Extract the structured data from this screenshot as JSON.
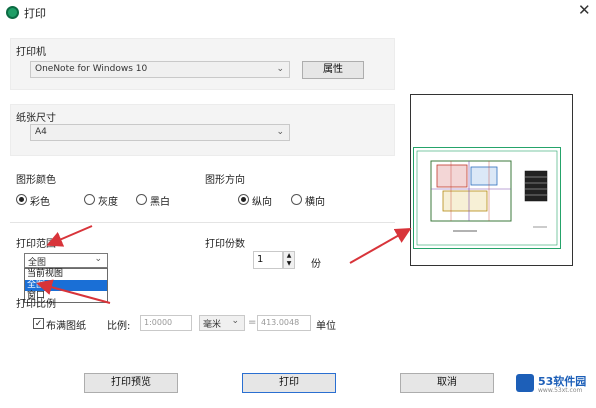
{
  "window": {
    "title": "打印",
    "close_glyph": "✕"
  },
  "printer": {
    "section_label": "打印机",
    "selected": "OneNote for Windows 10",
    "properties_button": "属性"
  },
  "paper": {
    "section_label": "纸张尺寸",
    "selected": "A4"
  },
  "color": {
    "section_label": "图形颜色",
    "options": [
      "彩色",
      "灰度",
      "黑白"
    ],
    "selected_index": 0
  },
  "orientation": {
    "section_label": "图形方向",
    "options": [
      "纵向",
      "横向"
    ],
    "selected_index": 0
  },
  "range": {
    "section_label": "打印范围",
    "selected": "全图",
    "options": [
      "当前视图",
      "全图",
      "窗口"
    ],
    "highlighted_index": 1
  },
  "copies": {
    "section_label": "打印份数",
    "value": "1",
    "unit": "份"
  },
  "scale": {
    "section_label": "打印比例",
    "fit_label": "布满图纸",
    "fit_checked": true,
    "ratio_label": "比例:",
    "ratio_value": "1:0000",
    "unit_selected": "毫米",
    "equals": "=",
    "drawing_value": "413.0048",
    "drawing_unit": "单位"
  },
  "buttons": {
    "preview": "打印预览",
    "print": "打印",
    "cancel": "取消"
  },
  "watermark": {
    "text": "53软件园",
    "sub": "www.53xt.com"
  },
  "colors": {
    "accent": "#1a6fd6",
    "arrow": "#d8343a",
    "drawing": "#25a36a"
  }
}
